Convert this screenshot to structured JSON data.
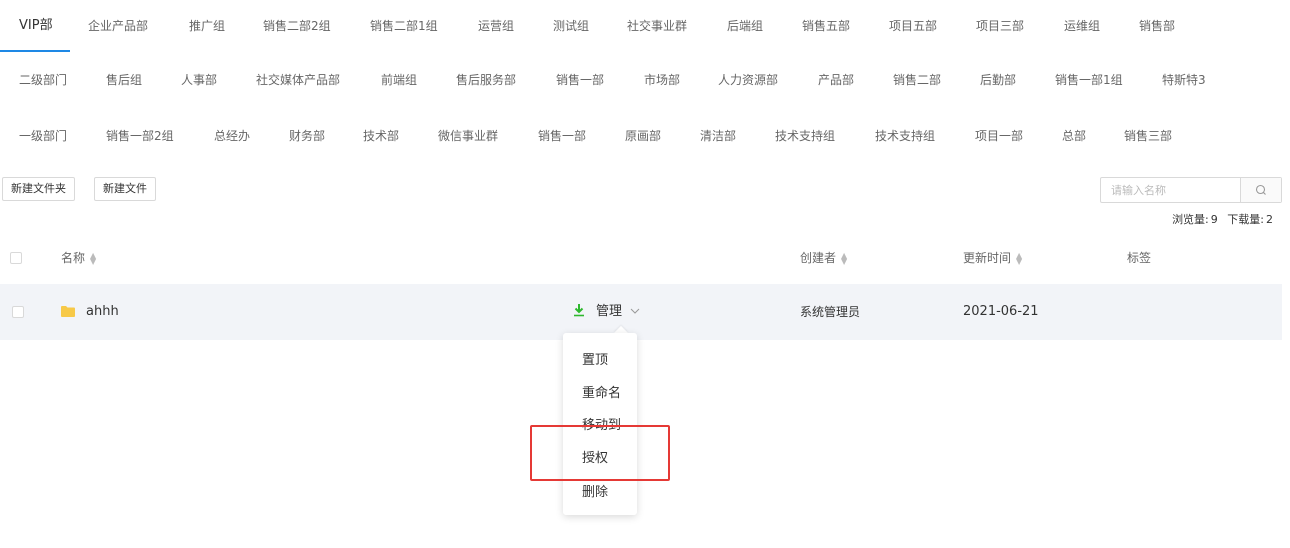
{
  "tabs": {
    "row1": [
      "VIP部",
      "企业产品部",
      "推广组",
      "销售二部2组",
      "销售二部1组",
      "运营组",
      "测试组",
      "社交事业群",
      "后端组",
      "销售五部",
      "项目五部",
      "项目三部",
      "运维组",
      "销售部"
    ],
    "row2": [
      "二级部门",
      "售后组",
      "人事部",
      "社交媒体产品部",
      "前端组",
      "售后服务部",
      "销售一部",
      "市场部",
      "人力资源部",
      "产品部",
      "销售二部",
      "后勤部",
      "销售一部1组",
      "特斯特3"
    ],
    "row3": [
      "一级部门",
      "销售一部2组",
      "总经办",
      "财务部",
      "技术部",
      "微信事业群",
      "销售一部",
      "原画部",
      "清洁部",
      "技术支持组",
      "技术支持组",
      "项目一部",
      "总部",
      "销售三部"
    ],
    "active": "VIP部"
  },
  "toolbar": {
    "new_folder": "新建文件夹",
    "new_file": "新建文件"
  },
  "search": {
    "placeholder": "请输入名称"
  },
  "stats": {
    "views_label": "浏览量:",
    "views": "9",
    "downloads_label": "下载量:",
    "downloads": "2"
  },
  "table": {
    "columns": {
      "name": "名称",
      "creator": "创建者",
      "updated": "更新时间",
      "tags": "标签"
    },
    "rows": [
      {
        "name": "ahhh",
        "action": "管理",
        "creator": "系统管理员",
        "updated": "2021-06-21",
        "tags": ""
      }
    ]
  },
  "menu": {
    "items": [
      "置顶",
      "重命名",
      "移动到",
      "授权",
      "删除"
    ],
    "highlighted": "授权"
  },
  "colors": {
    "accent": "#1e88e5",
    "download": "#2eb82e",
    "folder": "#f7c948",
    "highlight": "#e53935",
    "row_bg": "#f2f4f8"
  }
}
